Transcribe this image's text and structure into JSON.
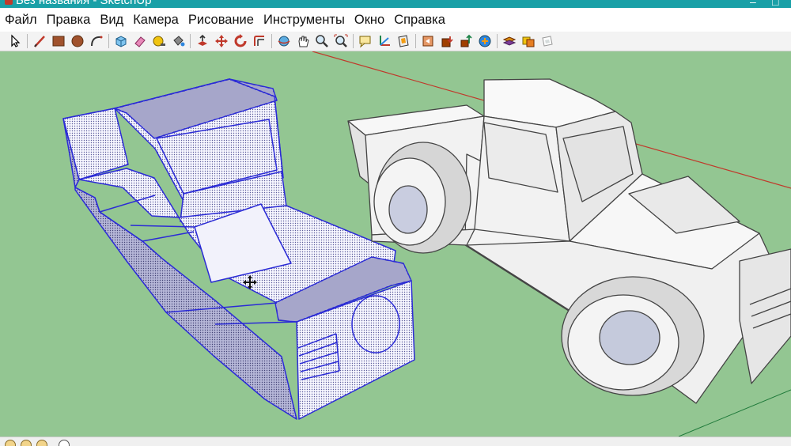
{
  "window": {
    "title": "Без названия - SketchUp"
  },
  "menu": [
    "Файл",
    "Правка",
    "Вид",
    "Камера",
    "Рисование",
    "Инструменты",
    "Окно",
    "Справка"
  ],
  "toolbar": {
    "tools": [
      "select-tool",
      "line-tool",
      "rectangle-tool",
      "circle-tool",
      "arc-tool",
      "make-component-tool",
      "eraser-tool",
      "tape-measure-tool",
      "paint-bucket-tool",
      "push-pull-tool",
      "move-tool",
      "rotate-tool",
      "offset-tool",
      "orbit-tool",
      "pan-tool",
      "zoom-tool",
      "zoom-extents-tool",
      "text-tool",
      "axes-tool",
      "section-plane-tool",
      "previous-view-tool",
      "get-models-tool",
      "share-model-tool",
      "extension-warehouse-tool",
      "layers-tool"
    ]
  },
  "colors": {
    "titlebar": "#19a0a7",
    "ground": "#93c692",
    "selection": "#2b2bd6",
    "model_face": "#f4f4f4"
  }
}
